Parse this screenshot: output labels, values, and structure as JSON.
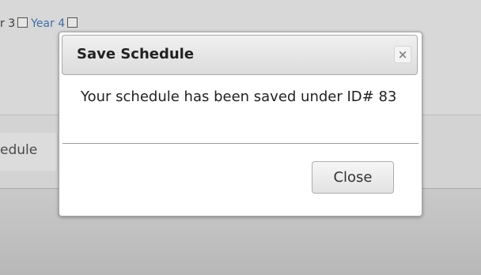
{
  "background": {
    "years": {
      "year3_label_fragment": "r 3",
      "year4_label_fragment": "Year 4"
    },
    "tab_label_fragment": "edule"
  },
  "dialog": {
    "title": "Save Schedule",
    "close_icon": "×",
    "message": "Your schedule has been saved under ID# 83",
    "close_button_label": "Close"
  },
  "colors": {
    "link": "#3d6fa8",
    "dialog_bg": "#ffffff",
    "overlay": "#d3d3d3"
  }
}
